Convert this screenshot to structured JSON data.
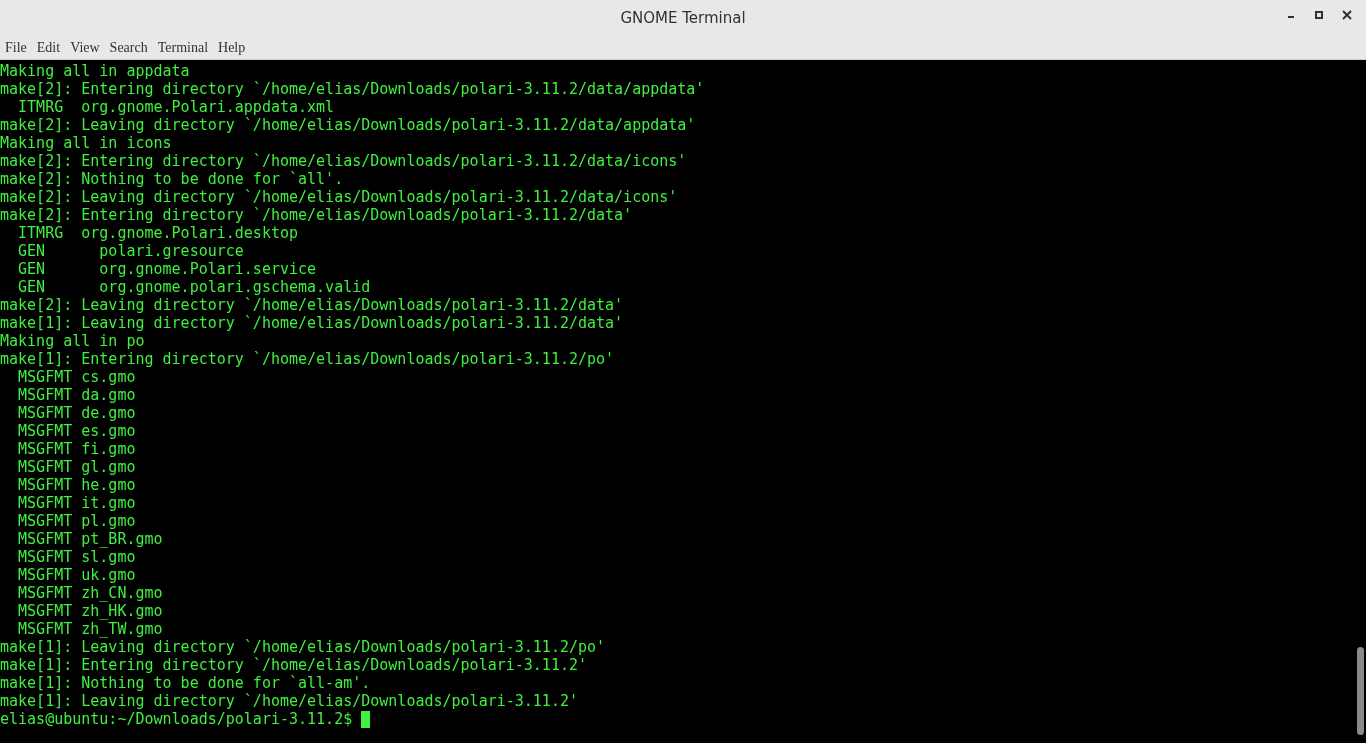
{
  "window": {
    "title": "GNOME Terminal"
  },
  "menu": [
    "File",
    "Edit",
    "View",
    "Search",
    "Terminal",
    "Help"
  ],
  "terminal": {
    "lines": [
      "Making all in appdata",
      "make[2]: Entering directory `/home/elias/Downloads/polari-3.11.2/data/appdata'",
      "  ITMRG  org.gnome.Polari.appdata.xml",
      "make[2]: Leaving directory `/home/elias/Downloads/polari-3.11.2/data/appdata'",
      "Making all in icons",
      "make[2]: Entering directory `/home/elias/Downloads/polari-3.11.2/data/icons'",
      "make[2]: Nothing to be done for `all'.",
      "make[2]: Leaving directory `/home/elias/Downloads/polari-3.11.2/data/icons'",
      "make[2]: Entering directory `/home/elias/Downloads/polari-3.11.2/data'",
      "  ITMRG  org.gnome.Polari.desktop",
      "  GEN      polari.gresource",
      "  GEN      org.gnome.Polari.service",
      "  GEN      org.gnome.polari.gschema.valid",
      "make[2]: Leaving directory `/home/elias/Downloads/polari-3.11.2/data'",
      "make[1]: Leaving directory `/home/elias/Downloads/polari-3.11.2/data'",
      "Making all in po",
      "make[1]: Entering directory `/home/elias/Downloads/polari-3.11.2/po'",
      "  MSGFMT cs.gmo",
      "  MSGFMT da.gmo",
      "  MSGFMT de.gmo",
      "  MSGFMT es.gmo",
      "  MSGFMT fi.gmo",
      "  MSGFMT gl.gmo",
      "  MSGFMT he.gmo",
      "  MSGFMT it.gmo",
      "  MSGFMT pl.gmo",
      "  MSGFMT pt_BR.gmo",
      "  MSGFMT sl.gmo",
      "  MSGFMT uk.gmo",
      "  MSGFMT zh_CN.gmo",
      "  MSGFMT zh_HK.gmo",
      "  MSGFMT zh_TW.gmo",
      "make[1]: Leaving directory `/home/elias/Downloads/polari-3.11.2/po'",
      "make[1]: Entering directory `/home/elias/Downloads/polari-3.11.2'",
      "make[1]: Nothing to be done for `all-am'.",
      "make[1]: Leaving directory `/home/elias/Downloads/polari-3.11.2'"
    ],
    "prompt": "elias@ubuntu:~/Downloads/polari-3.11.2$"
  }
}
